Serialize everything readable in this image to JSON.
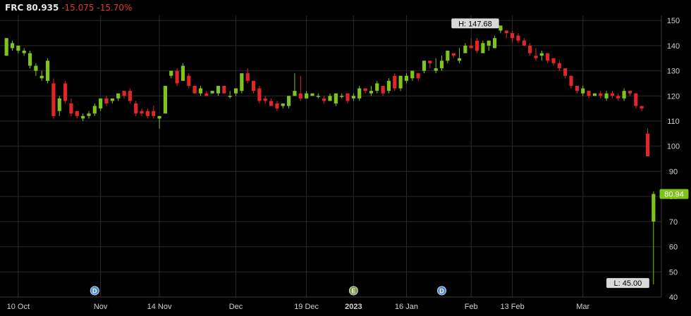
{
  "header": {
    "symbol": "FRC",
    "price": "80.935",
    "change": "-15.075",
    "change_pct": "-15.70%"
  },
  "colors": {
    "up": "#7fc31c",
    "down": "#e0262a",
    "grid": "#2a2a2a",
    "axis_text": "#d0d0d0",
    "last_badge": "#7fc31c"
  },
  "chart_data": {
    "type": "candlestick",
    "y_axis": {
      "ticks": [
        "150",
        "140",
        "130",
        "120",
        "110",
        "100",
        "90",
        "80",
        "70",
        "60",
        "50",
        "40"
      ],
      "ylim": [
        40,
        152
      ]
    },
    "x_axis": {
      "ticks": [
        {
          "label": "10 Oct",
          "i": 2
        },
        {
          "label": "Nov",
          "i": 16
        },
        {
          "label": "14 Nov",
          "i": 26
        },
        {
          "label": "Dec",
          "i": 39
        },
        {
          "label": "19 Dec",
          "i": 51
        },
        {
          "label": "2023",
          "i": 59
        },
        {
          "label": "16 Jan",
          "i": 68
        },
        {
          "label": "Feb",
          "i": 79
        },
        {
          "label": "13 Feb",
          "i": 86
        },
        {
          "label": "Mar",
          "i": 98
        }
      ]
    },
    "badges": {
      "high": "H: 147.68",
      "low": "L: 45.00",
      "last": "80.94"
    },
    "event_markers": [
      {
        "label": "D",
        "i": 15,
        "color": "#4a86d8"
      },
      {
        "label": "E",
        "i": 59,
        "color": "#7a9a3a"
      },
      {
        "label": "D",
        "i": 74,
        "color": "#4a86d8"
      }
    ],
    "candles": [
      [
        136,
        143,
        143,
        136
      ],
      [
        139,
        141,
        142,
        138
      ],
      [
        138,
        140,
        140,
        137
      ],
      [
        137,
        138,
        139,
        136
      ],
      [
        132,
        137,
        138,
        131
      ],
      [
        130,
        132,
        133,
        128
      ],
      [
        127,
        128,
        130,
        126
      ],
      [
        126,
        134,
        135,
        125
      ],
      [
        125,
        112,
        127,
        111
      ],
      [
        114,
        119,
        120,
        112
      ],
      [
        125,
        118,
        126,
        117
      ],
      [
        117,
        113,
        119,
        112
      ],
      [
        114,
        112,
        114,
        111
      ],
      [
        111,
        112,
        113,
        110
      ],
      [
        112,
        113,
        114,
        111
      ],
      [
        113,
        116,
        117,
        112
      ],
      [
        115,
        119,
        119,
        114
      ],
      [
        119,
        117,
        120,
        116
      ],
      [
        118,
        119,
        119,
        117
      ],
      [
        119,
        121,
        121,
        118
      ],
      [
        122,
        120,
        122,
        119
      ],
      [
        122,
        118,
        123,
        117
      ],
      [
        117,
        113,
        118,
        112
      ],
      [
        114,
        113,
        115,
        112
      ],
      [
        114,
        112,
        115,
        111
      ],
      [
        114,
        112,
        116,
        111
      ],
      [
        111,
        112,
        112,
        107
      ],
      [
        113,
        124,
        124,
        113
      ],
      [
        128,
        130,
        130,
        127
      ],
      [
        130,
        125,
        131,
        124
      ],
      [
        126,
        132,
        133,
        126
      ],
      [
        128,
        124,
        129,
        123
      ],
      [
        124,
        121,
        124,
        121
      ],
      [
        121,
        123,
        124,
        120
      ],
      [
        121,
        120,
        122,
        120
      ],
      [
        121,
        122,
        122,
        121
      ],
      [
        121,
        124,
        124,
        120
      ],
      [
        124,
        121,
        124,
        121
      ],
      [
        120,
        120,
        122,
        119
      ],
      [
        121,
        123,
        123,
        120
      ],
      [
        122,
        129,
        129,
        121
      ],
      [
        129,
        126,
        131,
        125
      ],
      [
        126,
        122,
        126,
        121
      ],
      [
        123,
        118,
        124,
        117
      ],
      [
        119,
        118,
        120,
        117
      ],
      [
        118,
        116,
        119,
        116
      ],
      [
        117,
        115,
        118,
        114
      ],
      [
        116,
        117,
        117,
        115
      ],
      [
        116,
        120,
        120,
        115
      ],
      [
        120,
        122,
        129,
        120
      ],
      [
        121,
        119,
        128,
        118
      ],
      [
        119,
        121,
        122,
        119
      ],
      [
        120,
        121,
        121,
        120
      ],
      [
        120,
        120,
        121,
        119
      ],
      [
        119,
        118,
        120,
        117
      ],
      [
        118,
        120,
        121,
        118
      ],
      [
        117,
        121,
        121,
        116
      ],
      [
        120,
        120,
        121,
        119
      ],
      [
        121,
        118,
        121,
        117
      ],
      [
        119,
        120,
        121,
        118
      ],
      [
        119,
        123,
        124,
        118
      ],
      [
        123,
        122,
        123,
        121
      ],
      [
        121,
        122,
        124,
        120
      ],
      [
        122,
        125,
        126,
        121
      ],
      [
        124,
        121,
        124,
        120
      ],
      [
        122,
        126,
        127,
        121
      ],
      [
        128,
        123,
        129,
        122
      ],
      [
        123,
        128,
        128,
        122
      ],
      [
        126,
        128,
        129,
        125
      ],
      [
        127,
        130,
        130,
        126
      ],
      [
        129,
        127,
        129,
        126
      ],
      [
        130,
        134,
        134,
        129
      ],
      [
        134,
        133,
        134,
        131
      ],
      [
        130,
        131,
        135,
        129
      ],
      [
        131,
        134,
        136,
        130
      ],
      [
        134,
        138,
        138,
        133
      ],
      [
        137,
        136,
        137,
        135
      ],
      [
        134,
        135,
        139,
        133
      ],
      [
        137,
        140,
        141,
        137
      ],
      [
        140,
        139,
        143,
        139
      ],
      [
        142,
        138,
        143,
        137
      ],
      [
        137,
        141,
        142,
        137
      ],
      [
        140,
        142,
        142,
        138
      ],
      [
        139,
        143,
        144,
        139
      ],
      [
        146,
        148,
        148,
        145
      ],
      [
        146,
        145,
        146,
        143
      ],
      [
        145,
        143,
        146,
        141
      ],
      [
        144,
        142,
        145,
        141
      ],
      [
        142,
        140,
        143,
        140
      ],
      [
        140,
        137,
        141,
        136
      ],
      [
        136,
        135,
        139,
        134
      ],
      [
        136,
        137,
        138,
        134
      ],
      [
        137,
        134,
        137,
        133
      ],
      [
        135,
        133,
        135,
        132
      ],
      [
        133,
        131,
        134,
        130
      ],
      [
        131,
        128,
        131,
        127
      ],
      [
        128,
        124,
        128,
        123
      ],
      [
        124,
        122,
        124,
        121
      ],
      [
        121,
        123,
        124,
        120
      ],
      [
        122,
        120,
        122,
        119
      ],
      [
        120,
        121,
        121,
        120
      ],
      [
        121,
        120,
        122,
        119
      ],
      [
        119,
        121,
        122,
        118
      ],
      [
        121,
        120,
        122,
        119
      ],
      [
        120,
        119,
        121,
        118
      ],
      [
        119,
        122,
        123,
        118
      ],
      [
        122,
        121,
        122,
        120
      ],
      [
        121,
        116,
        121,
        115
      ],
      [
        116,
        115,
        116,
        114
      ],
      [
        105,
        96,
        107,
        96
      ],
      [
        70,
        81,
        82,
        45
      ]
    ]
  }
}
